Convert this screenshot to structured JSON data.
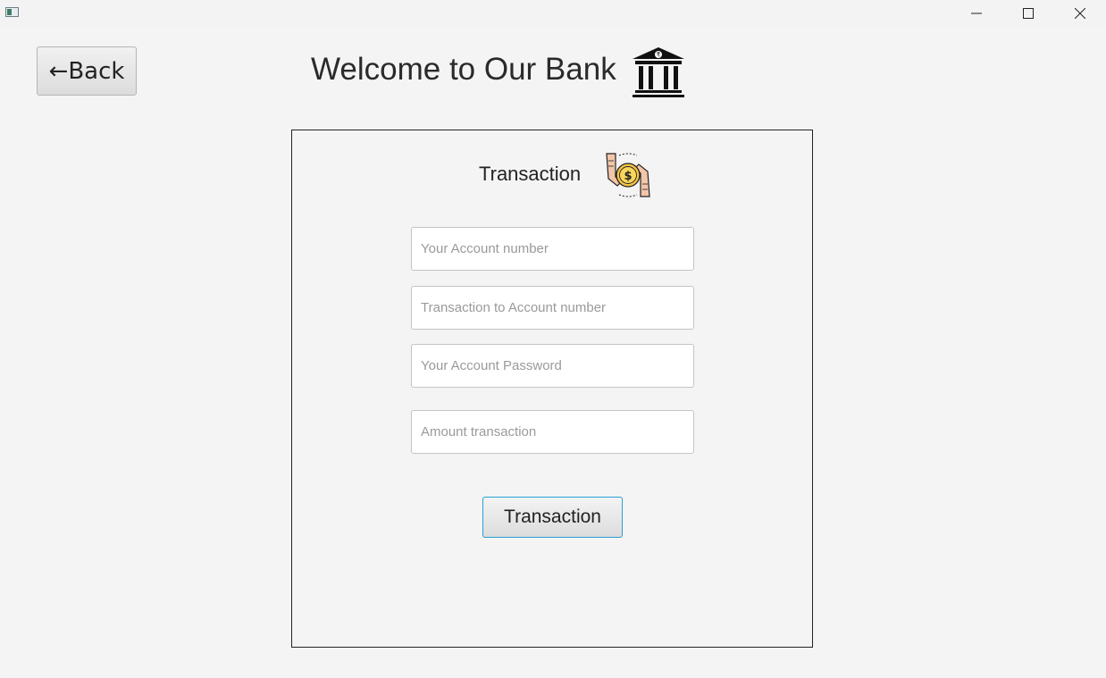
{
  "window": {
    "minimize_icon": "minimize-icon",
    "maximize_icon": "maximize-icon",
    "close_icon": "close-icon"
  },
  "header": {
    "back_label": "←Back",
    "title": "Welcome to Our Bank",
    "bank_icon": "bank-building-rupee-icon"
  },
  "panel": {
    "title": "Transaction",
    "icon": "money-exchange-hands-icon",
    "fields": [
      {
        "name": "your-account-number",
        "placeholder": "Your Account number",
        "value": ""
      },
      {
        "name": "to-account-number",
        "placeholder": "Transaction to Account number",
        "value": ""
      },
      {
        "name": "account-password",
        "placeholder": "Your Account Password",
        "value": ""
      },
      {
        "name": "amount",
        "placeholder": "Amount transaction",
        "value": ""
      }
    ],
    "submit_label": "Transaction"
  },
  "colors": {
    "background": "#f4f4f4",
    "focus_border": "#2a9fd6",
    "coin": "#f5c542",
    "hand": "#f2c6a8"
  }
}
